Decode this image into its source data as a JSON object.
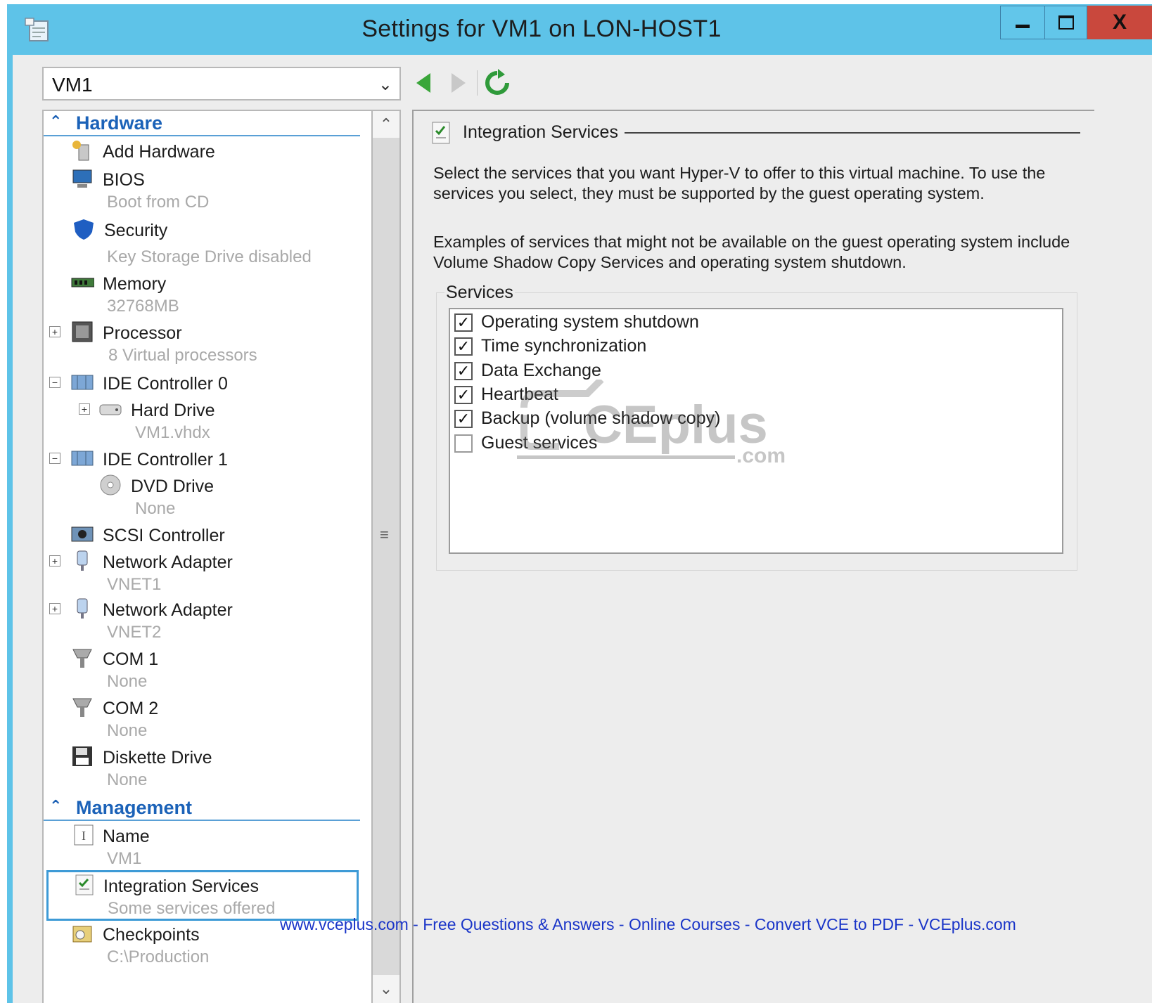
{
  "window": {
    "title": "Settings for  VM1  on LON-HOST1",
    "controls": {
      "minimize": "minimize",
      "maximize": "maximize",
      "close": "X"
    }
  },
  "toolbar": {
    "vm_selector": {
      "selected": "VM1"
    },
    "back_icon": "arrow-left-icon",
    "forward_icon": "arrow-right-icon",
    "refresh_icon": "refresh-icon"
  },
  "tree": {
    "hardware_header": "Hardware",
    "management_header": "Management",
    "items": {
      "add_hardware": {
        "label": "Add Hardware"
      },
      "bios": {
        "label": "BIOS",
        "sub": "Boot from CD"
      },
      "security": {
        "label": "Security",
        "sub": "Key Storage Drive disabled"
      },
      "memory": {
        "label": "Memory",
        "sub": "32768MB"
      },
      "processor": {
        "label": "Processor",
        "sub": "8 Virtual processors"
      },
      "ide0": {
        "label": "IDE Controller 0"
      },
      "hard_drive": {
        "label": "Hard Drive",
        "sub": "VM1.vhdx"
      },
      "ide1": {
        "label": "IDE Controller 1"
      },
      "dvd": {
        "label": "DVD Drive",
        "sub": "None"
      },
      "scsi": {
        "label": "SCSI Controller"
      },
      "net1": {
        "label": "Network Adapter",
        "sub": "VNET1"
      },
      "net2": {
        "label": "Network Adapter",
        "sub": "VNET2"
      },
      "com1": {
        "label": "COM 1",
        "sub": "None"
      },
      "com2": {
        "label": "COM 2",
        "sub": "None"
      },
      "diskette": {
        "label": "Diskette Drive",
        "sub": "None"
      },
      "name": {
        "label": "Name",
        "sub": "VM1"
      },
      "integration": {
        "label": "Integration Services",
        "sub": "Some services offered"
      },
      "checkpoints": {
        "label": "Checkpoints",
        "sub": "C:\\Production"
      }
    }
  },
  "panel": {
    "title": "Integration Services",
    "description1": "Select the services that you want Hyper-V to offer to this virtual machine. To use the services you select, they must  be supported by the guest operating system.",
    "description2": "Examples of services that might not be available on the guest operating system include Volume Shadow Copy Services and operating system shutdown.",
    "group_label": "Services",
    "services": [
      {
        "label": "Operating system shutdown",
        "checked": true
      },
      {
        "label": "Time synchronization",
        "checked": true
      },
      {
        "label": "Data Exchange",
        "checked": true
      },
      {
        "label": "Heartbeat",
        "checked": true
      },
      {
        "label": "Backup (volume shadow copy)",
        "checked": true
      },
      {
        "label": "Guest services",
        "checked": false
      }
    ]
  },
  "watermark": {
    "text": "CEplus",
    "suffix": ".com"
  },
  "footer": "www.vceplus.com - Free Questions & Answers - Online Courses - Convert VCE to PDF - VCEplus.com",
  "colors": {
    "titlebar": "#5ec3e8",
    "close": "#c9483d",
    "accent": "#1b62b8",
    "link": "#1a35c8"
  }
}
